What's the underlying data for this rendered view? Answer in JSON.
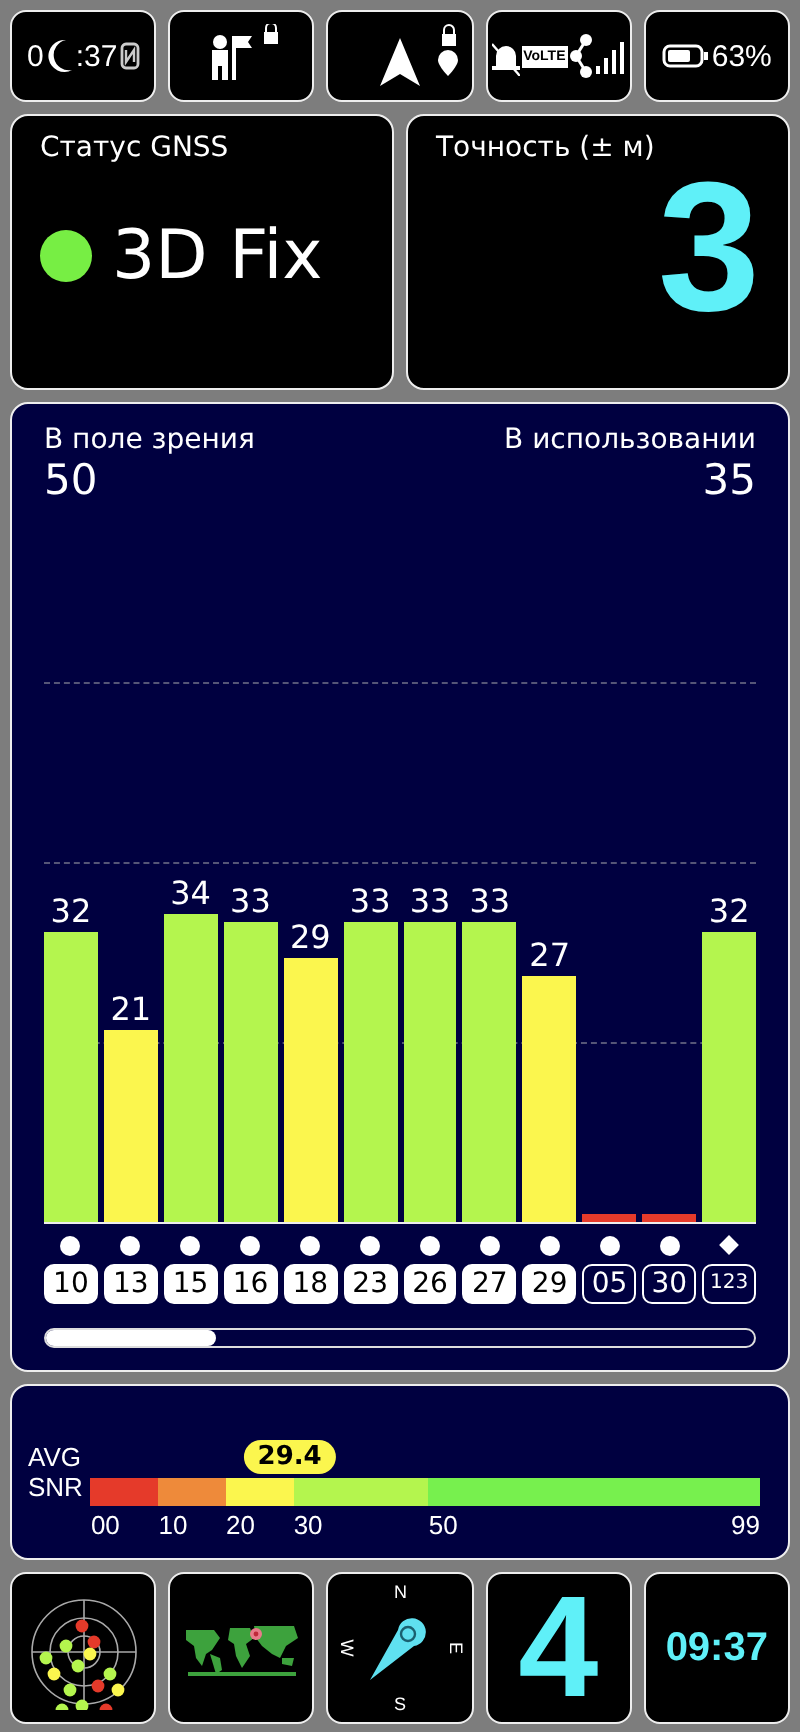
{
  "status_bar": {
    "time_start": "0",
    "time_end": ":37",
    "volte": "VoLTE",
    "battery": "63%"
  },
  "gnss_status": {
    "title": "Статус GNSS",
    "value": "3D Fix",
    "color": "#77ee44"
  },
  "accuracy": {
    "title": "Точность (± м)",
    "value": "3"
  },
  "satellites": {
    "in_view_label": "В поле зрения",
    "in_view": "50",
    "in_use_label": "В использовании",
    "in_use": "35",
    "chart_data": {
      "type": "bar",
      "categories": [
        "10",
        "13",
        "15",
        "16",
        "18",
        "23",
        "26",
        "27",
        "29",
        "05",
        "30",
        "123"
      ],
      "values": [
        32,
        21,
        34,
        33,
        29,
        33,
        33,
        33,
        27,
        0,
        0,
        32
      ],
      "value_labels": [
        "32",
        "21",
        "34",
        "33",
        "29",
        "33",
        "33",
        "33",
        "27",
        null,
        null,
        "32"
      ]
    },
    "sats": [
      {
        "used": true,
        "kind": "dot"
      },
      {
        "used": true,
        "kind": "dot"
      },
      {
        "used": true,
        "kind": "dot"
      },
      {
        "used": true,
        "kind": "dot"
      },
      {
        "used": true,
        "kind": "dot"
      },
      {
        "used": true,
        "kind": "dot"
      },
      {
        "used": true,
        "kind": "dot"
      },
      {
        "used": true,
        "kind": "dot"
      },
      {
        "used": true,
        "kind": "dot"
      },
      {
        "used": false,
        "kind": "dot"
      },
      {
        "used": false,
        "kind": "dot"
      },
      {
        "used": false,
        "kind": "diamond"
      }
    ]
  },
  "snr": {
    "label_top": "AVG",
    "label_bottom": "SNR",
    "value": "29.4",
    "level": 0.297,
    "ticks": [
      "00",
      "10",
      "20",
      "30",
      "50",
      "99"
    ],
    "segments": [
      {
        "color": "#e53a2a"
      },
      {
        "color": "#ee8a3a"
      },
      {
        "color": "#fbf64e"
      },
      {
        "color": "#b4f54e"
      },
      {
        "color": "#77f04e"
      }
    ]
  },
  "bottom_tiles": [
    {
      "kind": "radar"
    },
    {
      "kind": "map"
    },
    {
      "kind": "compass",
      "north": "N",
      "west": "W",
      "east": "E",
      "south": "S"
    },
    {
      "kind": "big",
      "value": "4"
    },
    {
      "kind": "clock",
      "value": "09:37"
    }
  ]
}
